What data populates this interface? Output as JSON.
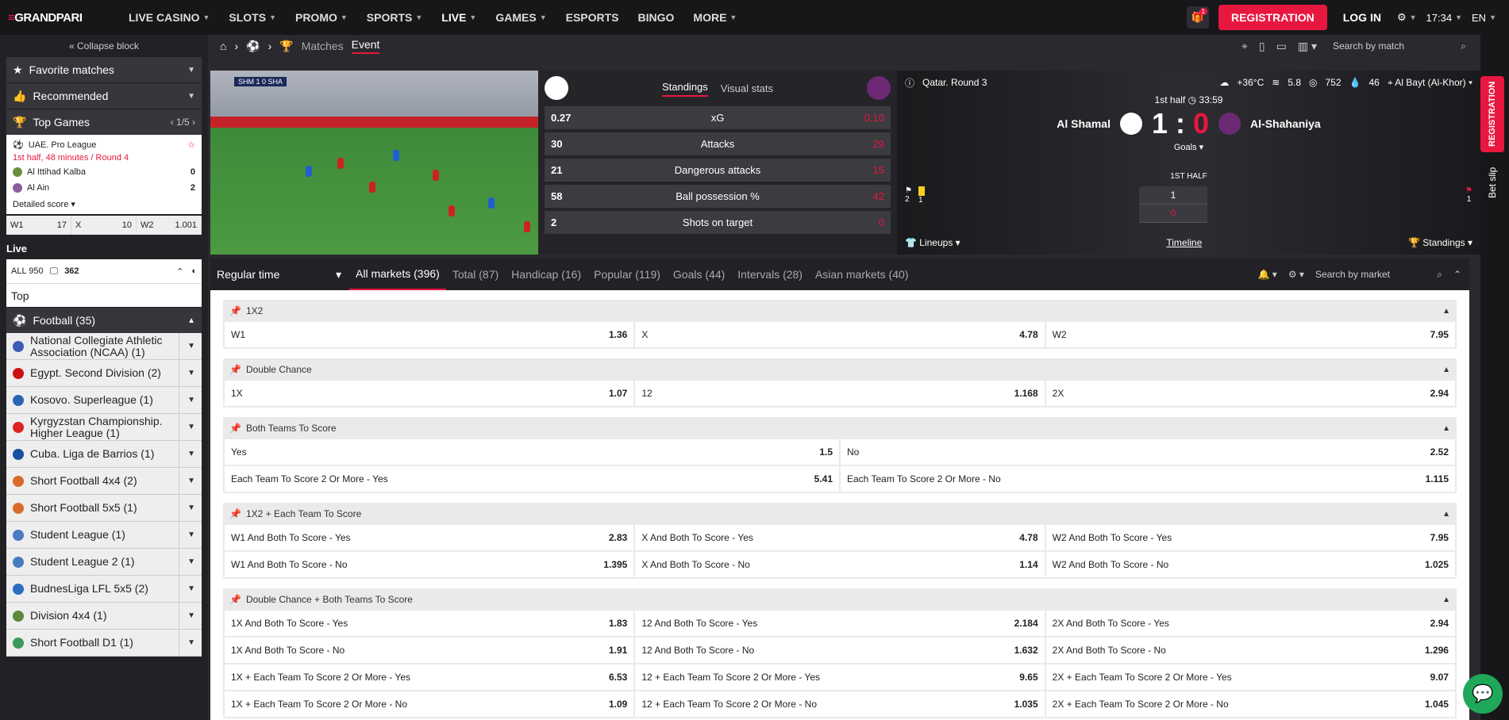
{
  "header": {
    "logo": "GRANDPARI",
    "nav": [
      "LIVE CASINO",
      "SLOTS",
      "PROMO",
      "SPORTS",
      "LIVE",
      "GAMES",
      "ESPORTS",
      "BINGO",
      "MORE"
    ],
    "registration": "REGISTRATION",
    "login": "LOG IN",
    "time": "17:34",
    "lang": "EN",
    "gift_badge": "1"
  },
  "sidebar": {
    "collapse": "Collapse block",
    "favorites": "Favorite matches",
    "recommended": "Recommended",
    "top_games": "Top Games",
    "pager": "1/5",
    "game": {
      "league": "UAE. Pro League",
      "status": "1st half, 48 minutes / Round 4",
      "team1": "Al Ittihad Kalba",
      "score1": "0",
      "team2": "Al Ain",
      "score2": "2",
      "detailed": "Detailed score"
    },
    "odds": [
      {
        "k": "W1",
        "v": "17"
      },
      {
        "k": "X",
        "v": "10"
      },
      {
        "k": "W2",
        "v": "1.001"
      }
    ],
    "live": "Live",
    "all": "ALL 950",
    "tv": "362",
    "top": "Top",
    "football": "Football (35)",
    "leagues": [
      "National Collegiate Athletic Association (NCAA) (1)",
      "Egypt. Second Division (2)",
      "Kosovo. Superleague (1)",
      "Kyrgyzstan Championship. Higher League (1)",
      "Cuba. Liga de Barrios (1)",
      "Short Football 4x4 (2)",
      "Short Football 5x5 (1)",
      "Student League (1)",
      "Student League 2 (1)",
      "BudnesLiga LFL 5x5 (2)",
      "Division 4x4 (1)",
      "Short Football D1 (1)"
    ]
  },
  "breadcrumb": {
    "matches": "Matches",
    "event": "Event",
    "search": "Search by match"
  },
  "video": {
    "score_overlay": "SHM 1 0 SHA"
  },
  "stats": {
    "tab1": "Standings",
    "tab2": "Visual stats",
    "rows": [
      {
        "l": "0.27",
        "m": "xG",
        "r": "0.10"
      },
      {
        "l": "30",
        "m": "Attacks",
        "r": "29"
      },
      {
        "l": "21",
        "m": "Dangerous attacks",
        "r": "15"
      },
      {
        "l": "58",
        "m": "Ball possession %",
        "r": "42"
      },
      {
        "l": "2",
        "m": "Shots on target",
        "r": "0"
      }
    ]
  },
  "scoreboard": {
    "round": "Qatar. Round 3",
    "temp": "+36°C",
    "wind": "5.8",
    "pressure": "752",
    "humidity": "46",
    "venue": "Al Bayt (Al-Khor)",
    "half": "1st half",
    "clock": "33:59",
    "team1": "Al Shamal",
    "team2": "Al-Shahaniya",
    "score1": "1",
    "score2": "0",
    "goals": "Goals",
    "first_half": "1ST HALF",
    "h1": "1",
    "h2": "0",
    "corners": "2",
    "yellows": "1",
    "corners2": "1",
    "lineups": "Lineups",
    "timeline": "Timeline",
    "standings": "Standings"
  },
  "markets_header": {
    "regular": "Regular time",
    "tabs": [
      "All markets (396)",
      "Total (87)",
      "Handicap (16)",
      "Popular (119)",
      "Goals (44)",
      "Intervals (28)",
      "Asian markets (40)"
    ],
    "search": "Search by market"
  },
  "markets": [
    {
      "title": "1X2",
      "cols": 3,
      "odds": [
        [
          "W1",
          "1.36"
        ],
        [
          "X",
          "4.78"
        ],
        [
          "W2",
          "7.95"
        ]
      ]
    },
    {
      "title": "Double Chance",
      "cols": 3,
      "odds": [
        [
          "1X",
          "1.07"
        ],
        [
          "12",
          "1.168"
        ],
        [
          "2X",
          "2.94"
        ]
      ]
    },
    {
      "title": "Both Teams To Score",
      "cols": 2,
      "odds": [
        [
          "Yes",
          "1.5"
        ],
        [
          "No",
          "2.52"
        ],
        [
          "Each Team To Score 2 Or More - Yes",
          "5.41"
        ],
        [
          "Each Team To Score 2 Or More - No",
          "1.115"
        ]
      ]
    },
    {
      "title": "1X2 + Each Team To Score",
      "cols": 3,
      "odds": [
        [
          "W1 And Both To Score - Yes",
          "2.83"
        ],
        [
          "X And Both To Score - Yes",
          "4.78"
        ],
        [
          "W2 And Both To Score - Yes",
          "7.95"
        ],
        [
          "W1 And Both To Score - No",
          "1.395"
        ],
        [
          "X And Both To Score - No",
          "1.14"
        ],
        [
          "W2 And Both To Score - No",
          "1.025"
        ]
      ]
    },
    {
      "title": "Double Chance + Both Teams To Score",
      "cols": 3,
      "odds": [
        [
          "1X And Both To Score - Yes",
          "1.83"
        ],
        [
          "12 And Both To Score - Yes",
          "2.184"
        ],
        [
          "2X And Both To Score - Yes",
          "2.94"
        ],
        [
          "1X And Both To Score - No",
          "1.91"
        ],
        [
          "12 And Both To Score - No",
          "1.632"
        ],
        [
          "2X And Both To Score - No",
          "1.296"
        ],
        [
          "1X + Each Team To Score 2 Or More - Yes",
          "6.53"
        ],
        [
          "12 + Each Team To Score 2 Or More - Yes",
          "9.65"
        ],
        [
          "2X + Each Team To Score 2 Or More - Yes",
          "9.07"
        ],
        [
          "1X + Each Team To Score 2 Or More - No",
          "1.09"
        ],
        [
          "12 + Each Team To Score 2 Or More - No",
          "1.035"
        ],
        [
          "2X + Each Team To Score 2 Or More - No",
          "1.045"
        ]
      ]
    }
  ],
  "rail": {
    "registration": "REGISTRATION",
    "betslip": "Bet slip"
  }
}
